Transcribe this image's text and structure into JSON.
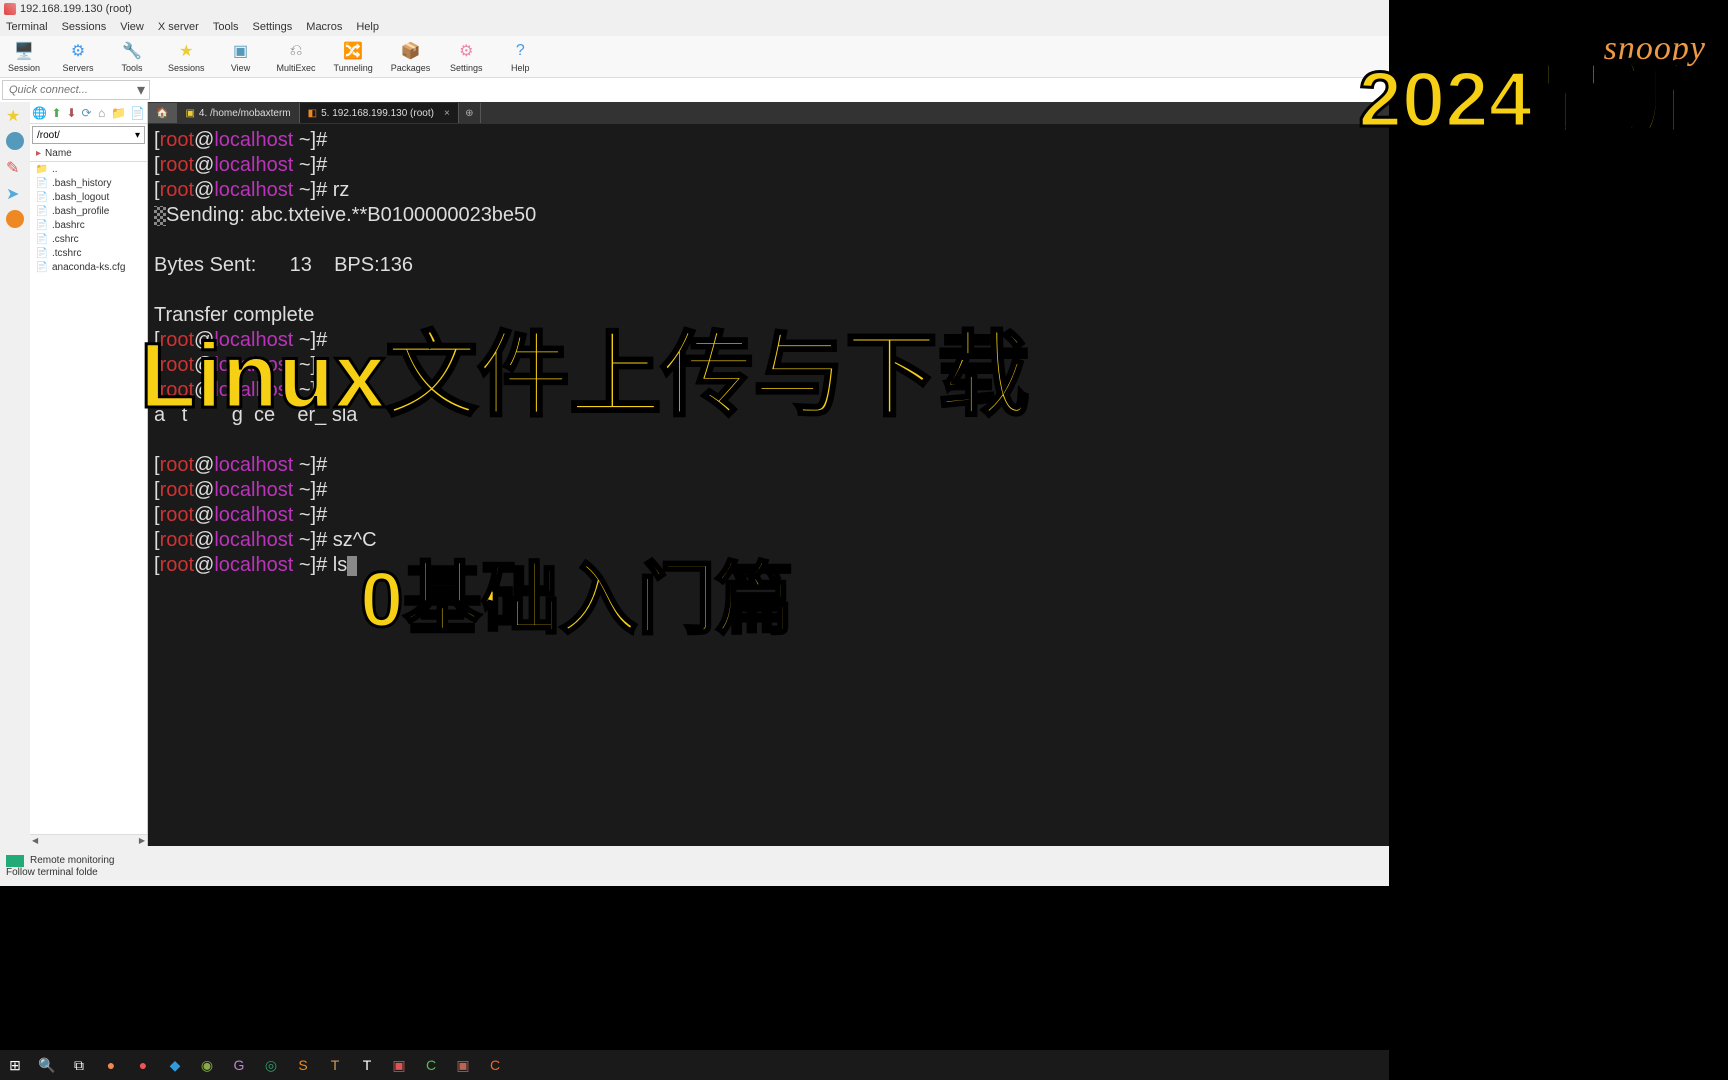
{
  "window": {
    "title": "192.168.199.130 (root)"
  },
  "menu": [
    "Terminal",
    "Sessions",
    "View",
    "X server",
    "Tools",
    "Settings",
    "Macros",
    "Help"
  ],
  "toolbar": [
    {
      "label": "Session",
      "icon": "🖥️",
      "color": "#3aa"
    },
    {
      "label": "Servers",
      "icon": "⚙",
      "color": "#49e"
    },
    {
      "label": "Tools",
      "icon": "🔧",
      "color": "#d44"
    },
    {
      "label": "Sessions",
      "icon": "★",
      "color": "#ec3"
    },
    {
      "label": "View",
      "icon": "▣",
      "color": "#59b"
    },
    {
      "label": "MultiExec",
      "icon": "⎌",
      "color": "#888"
    },
    {
      "label": "Tunneling",
      "icon": "🔀",
      "color": "#888"
    },
    {
      "label": "Packages",
      "icon": "📦",
      "color": "#888"
    },
    {
      "label": "Settings",
      "icon": "⚙",
      "color": "#e8a"
    },
    {
      "label": "Help",
      "icon": "?",
      "color": "#49e"
    }
  ],
  "quickconnect": {
    "placeholder": "Quick connect..."
  },
  "sidebar": {
    "path": "/root/",
    "header": "Name",
    "items": [
      {
        "name": "..",
        "type": "up"
      },
      {
        "name": ".bash_history",
        "type": "file"
      },
      {
        "name": ".bash_logout",
        "type": "file"
      },
      {
        "name": ".bash_profile",
        "type": "file"
      },
      {
        "name": ".bashrc",
        "type": "file"
      },
      {
        "name": ".cshrc",
        "type": "file"
      },
      {
        "name": ".tcshrc",
        "type": "file"
      },
      {
        "name": "anaconda-ks.cfg",
        "type": "cfg"
      }
    ]
  },
  "tabs": [
    {
      "label": "",
      "type": "home"
    },
    {
      "label": "4. /home/mobaxterm",
      "type": "normal"
    },
    {
      "label": "5. 192.168.199.130 (root)",
      "type": "active"
    }
  ],
  "terminal": {
    "sending": "Sending: abc.txteive.**B0100000023be50",
    "bytes": "Bytes Sent:      13    BPS:136",
    "transfer": "Transfer complete",
    "cmd_rz": "rz",
    "cmd_sz": "sz^C",
    "cmd_ls": "ls",
    "gibberish": "a   t        g  ce    er_ sla"
  },
  "status": {
    "remote": "Remote monitoring",
    "follow": "Follow terminal folde"
  },
  "overlay": {
    "year": "2024最新",
    "title": "Linux文件上传与下载",
    "sub": "0基础入门篇",
    "brand": "snoopy"
  },
  "taskbar_icons": [
    "⊞",
    "🔍",
    "⧉",
    "●",
    "●",
    "◆",
    "◉",
    "G",
    "◎",
    "S",
    "T",
    "T",
    "▣",
    "C",
    "▣",
    "C"
  ],
  "taskbar_colors": [
    "#fff",
    "#fff",
    "#fff",
    "#e85",
    "#e55",
    "#39d",
    "#8a4",
    "#b8c",
    "#396",
    "#e82",
    "#c95",
    "#fff",
    "#d55",
    "#5b5",
    "#b65",
    "#e63"
  ]
}
